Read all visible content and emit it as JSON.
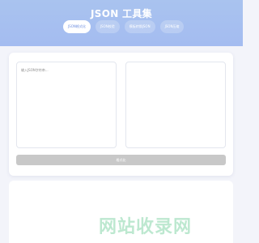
{
  "header": {
    "title": "JSON 工具集"
  },
  "tabs": [
    {
      "label": "JSON格式化",
      "active": true
    },
    {
      "label": "JSON校验",
      "active": false
    },
    {
      "label": "模板转换JSON",
      "active": false
    },
    {
      "label": "JSON压缩",
      "active": false
    }
  ],
  "editor": {
    "input_placeholder": "输入JSON字符串...",
    "output_value": ""
  },
  "action": {
    "button_label": "格式化"
  },
  "watermark": {
    "text": "网站收录网"
  },
  "colors": {
    "header_gradient_start": "#a9c3ef",
    "header_gradient_end": "#a4bcf0",
    "active_tab_text": "#6f8fe0",
    "button_disabled": "#c8c8c8",
    "background": "#f3f4fa"
  }
}
